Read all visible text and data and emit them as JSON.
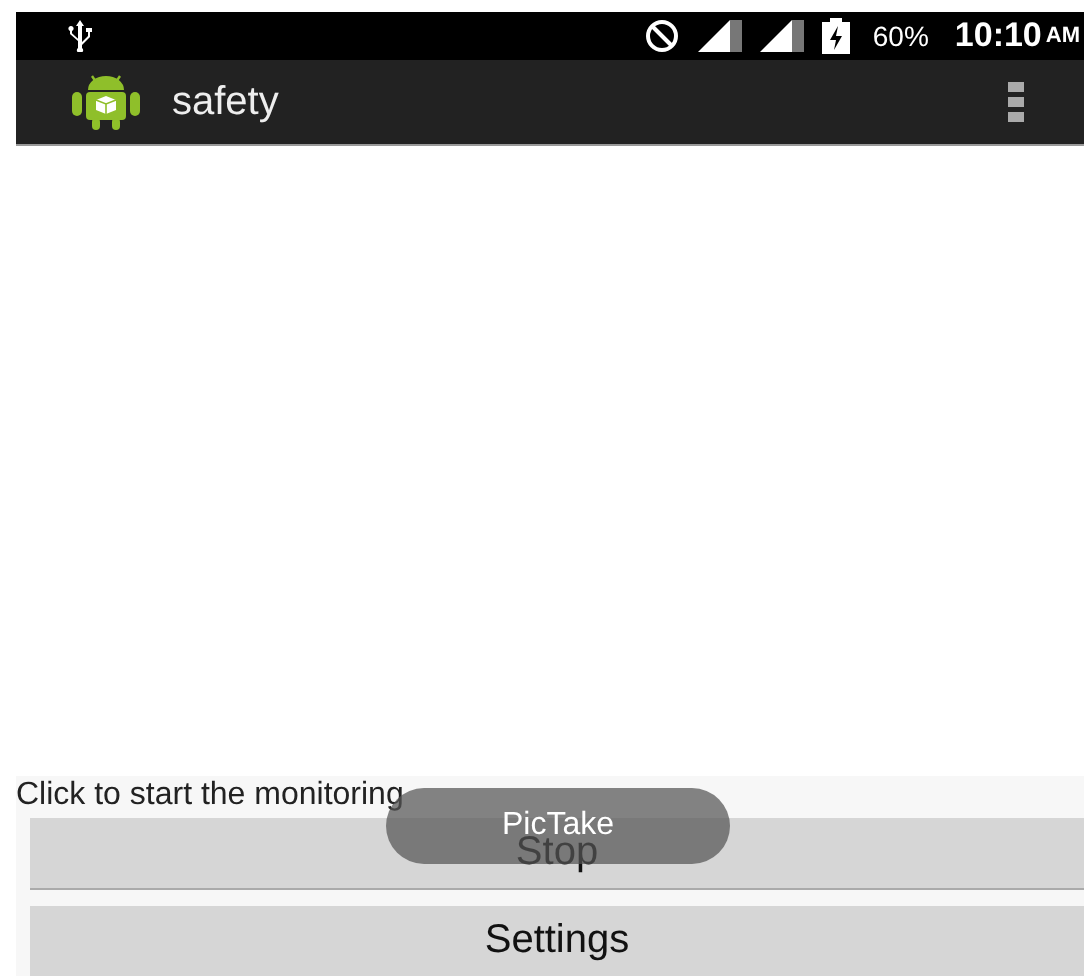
{
  "status_bar": {
    "battery": "60%",
    "time": "10:10",
    "time_suffix": "AM"
  },
  "action_bar": {
    "title": "safety"
  },
  "message": "Click to start the monitoring",
  "buttons": [
    {
      "label": "Stop"
    },
    {
      "label": "Settings"
    }
  ],
  "toast": {
    "text": "PicTake"
  }
}
